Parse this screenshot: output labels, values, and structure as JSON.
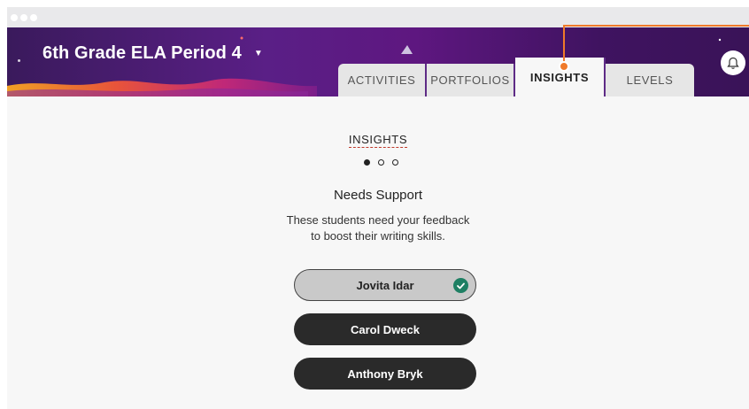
{
  "header": {
    "class_name": "6th Grade ELA Period 4",
    "class_caret": "▼",
    "tabs": [
      {
        "label": "ACTIVITIES",
        "active": false
      },
      {
        "label": "PORTFOLIOS",
        "active": false
      },
      {
        "label": "INSIGHTS",
        "active": true
      },
      {
        "label": "LEVELS",
        "active": false
      }
    ],
    "bell_icon": "bell-icon"
  },
  "main": {
    "section_title": "INSIGHTS",
    "pager": {
      "total": 3,
      "current": 1
    },
    "card_title": "Needs Support",
    "card_desc_line1": "These students need your feedback",
    "card_desc_line2": "to boost their writing skills.",
    "students": [
      {
        "name": "Jovita Idar",
        "selected": true
      },
      {
        "name": "Carol Dweck",
        "selected": false
      },
      {
        "name": "Anthony Bryk",
        "selected": false
      }
    ]
  },
  "colors": {
    "header_purple": "#5a1f86",
    "accent_orange": "#f07a2a",
    "check_green": "#1e7f63",
    "button_dark": "#2a2a2a"
  }
}
